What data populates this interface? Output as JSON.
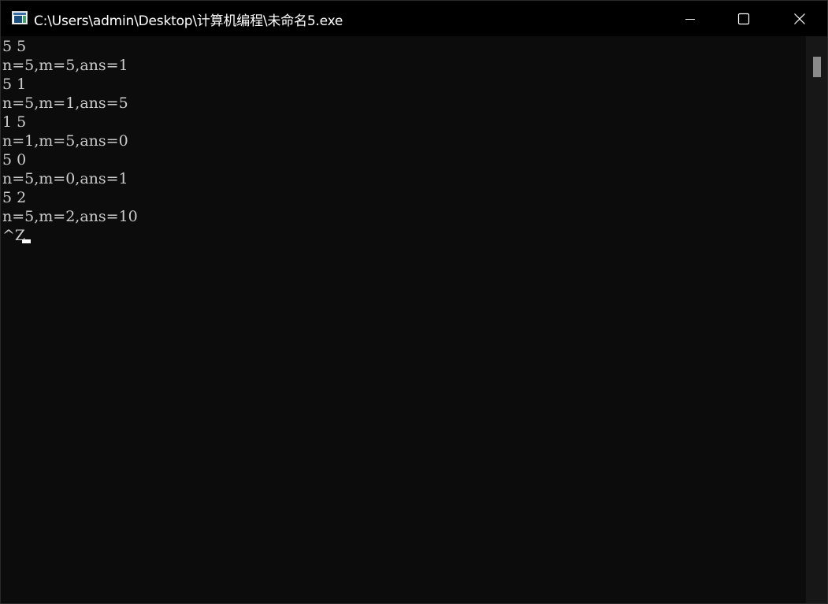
{
  "window": {
    "title": "C:\\Users\\admin\\Desktop\\计算机编程\\未命名5.exe",
    "icon": "console-app-icon",
    "controls": {
      "minimize": "minimize-icon",
      "maximize": "maximize-icon",
      "close": "close-icon"
    }
  },
  "console": {
    "lines": [
      "5 5",
      "n=5,m=5,ans=1",
      "5 1",
      "n=5,m=1,ans=5",
      "1 5",
      "n=1,m=5,ans=0",
      "5 0",
      "n=5,m=0,ans=1",
      "5 2",
      "n=5,m=2,ans=10",
      "^Z"
    ],
    "text_color": "#cccccc",
    "background": "#0c0c0c"
  }
}
